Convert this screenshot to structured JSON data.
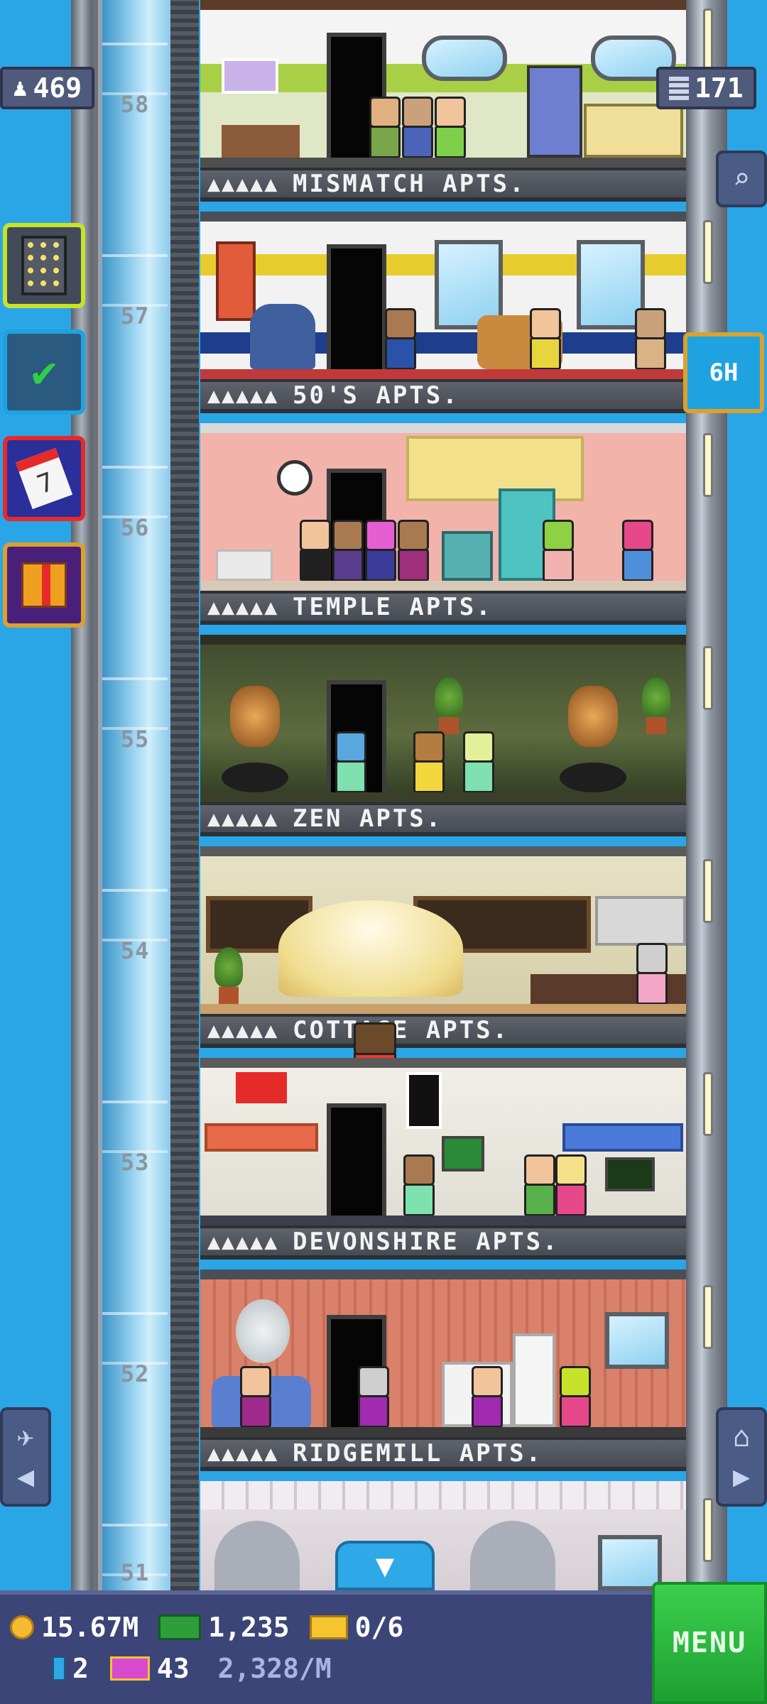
{
  "stats": {
    "population": "469",
    "floors": "171"
  },
  "floors": [
    {
      "number": "58",
      "stars": "▲▲▲▲▲",
      "name": "MISMATCH APTS."
    },
    {
      "number": "57",
      "stars": "▲▲▲▲▲",
      "name": "50'S APTS."
    },
    {
      "number": "56",
      "stars": "▲▲▲▲▲",
      "name": "TEMPLE APTS."
    },
    {
      "number": "55",
      "stars": "▲▲▲▲▲",
      "name": "ZEN APTS."
    },
    {
      "number": "54",
      "stars": "▲▲▲▲▲",
      "name": "COTTAGE APTS."
    },
    {
      "number": "53",
      "stars": "▲▲▲▲▲",
      "name": "DEVONSHIRE APTS."
    },
    {
      "number": "52",
      "stars": "▲▲▲▲▲",
      "name": "RIDGEMILL APTS."
    },
    {
      "number": "51",
      "stars": "",
      "name": ""
    }
  ],
  "side_buttons": [
    {
      "icon": "building-grid-icon",
      "color": "#c6e22a"
    },
    {
      "icon": "checklist-icon",
      "color": "#1fa3e0"
    },
    {
      "icon": "calendar-icon",
      "color": "#e52a2a"
    },
    {
      "icon": "gift-icon",
      "color": "#d9a12e"
    }
  ],
  "tab_6h": "6H",
  "bottom_bar": {
    "coins": "15.67M",
    "bux": "1,235",
    "tickets": "0/6",
    "elevators": "2",
    "vip": "43",
    "rate": "2,328/M",
    "menu": "MENU"
  },
  "colors": {
    "sky": "#2aa6e6",
    "menu_green": "#2fbf44",
    "bar_blue": "#3b4578",
    "coin_gold": "#f5b932",
    "bux_green": "#2e9e3a"
  }
}
